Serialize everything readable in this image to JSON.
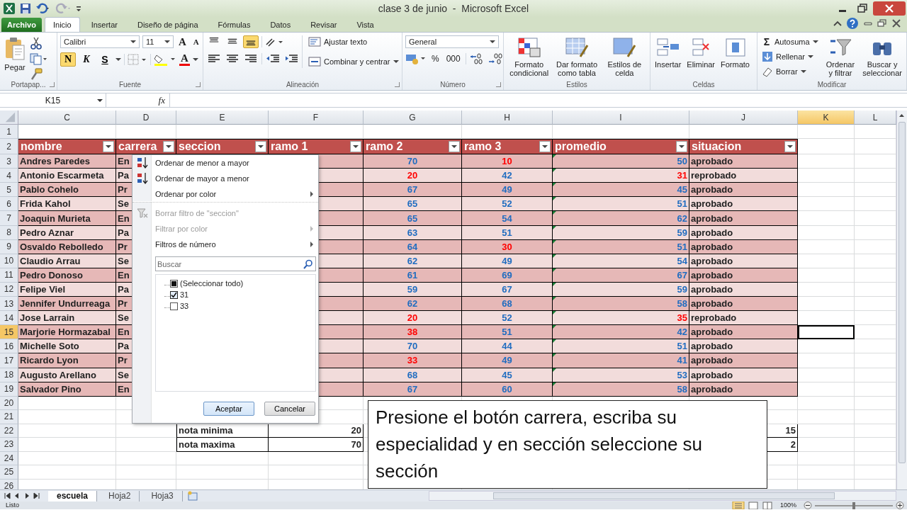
{
  "window": {
    "title": "clase 3 de junio  -  Microsoft Excel"
  },
  "ribbon_tabs": [
    {
      "label": "Archivo",
      "kind": "file",
      "selected": false
    },
    {
      "label": "Inicio",
      "kind": "tab",
      "selected": true
    },
    {
      "label": "Insertar",
      "kind": "tab",
      "selected": false
    },
    {
      "label": "Diseño de página",
      "kind": "tab",
      "selected": false
    },
    {
      "label": "Fórmulas",
      "kind": "tab",
      "selected": false
    },
    {
      "label": "Datos",
      "kind": "tab",
      "selected": false
    },
    {
      "label": "Revisar",
      "kind": "tab",
      "selected": false
    },
    {
      "label": "Vista",
      "kind": "tab",
      "selected": false
    }
  ],
  "clipboard": {
    "label": "Portapap...",
    "paste": "Pegar"
  },
  "font": {
    "label": "Fuente",
    "family": "Calibri",
    "size": "11",
    "size_glyphs": [
      "A",
      "A"
    ],
    "color_glyph": "A",
    "styles": [
      {
        "label": "N",
        "kind": "bold",
        "selected": true
      },
      {
        "label": "K",
        "kind": "italic",
        "selected": false
      },
      {
        "label": "S",
        "kind": "underline",
        "selected": false
      }
    ]
  },
  "alignment": {
    "label": "Alineación",
    "vertical": [
      {
        "selected": false
      },
      {
        "selected": false
      },
      {
        "selected": true
      }
    ],
    "wrap": "Ajustar texto",
    "merge": "Combinar y centrar"
  },
  "number": {
    "label": "Número",
    "format": "General",
    "percent": "%",
    "thousands": "000"
  },
  "styles": {
    "label": "Estilos",
    "buttons": [
      {
        "label": "Formato condicional",
        "kind": "conditional"
      },
      {
        "label": "Dar formato como tabla",
        "kind": "table"
      },
      {
        "label": "Estilos de celda",
        "kind": "cell"
      }
    ]
  },
  "cells": {
    "label": "Celdas",
    "buttons": [
      {
        "label": "Insertar",
        "kind": "insert"
      },
      {
        "label": "Eliminar",
        "kind": "delete"
      },
      {
        "label": "Formato",
        "kind": "format"
      }
    ]
  },
  "editing": {
    "label": "Modificar",
    "small": [
      {
        "label": "Autosuma",
        "kind": "sum",
        "glyph": "Σ"
      },
      {
        "label": "Rellenar",
        "kind": "fill"
      },
      {
        "label": "Borrar",
        "kind": "clear"
      }
    ],
    "big": [
      {
        "label": "Ordenar y filtrar",
        "kind": "sort"
      },
      {
        "label": "Buscar y seleccionar",
        "kind": "find"
      }
    ]
  },
  "formula_bar": {
    "name_box": "K15",
    "function_label": "fx"
  },
  "columns": [
    {
      "label": "C",
      "selected": false
    },
    {
      "label": "D",
      "selected": false
    },
    {
      "label": "E",
      "selected": false
    },
    {
      "label": "F",
      "selected": false
    },
    {
      "label": "G",
      "selected": false
    },
    {
      "label": "H",
      "selected": false
    },
    {
      "label": "I",
      "selected": false
    },
    {
      "label": "J",
      "selected": false
    },
    {
      "label": "K",
      "selected": true
    },
    {
      "label": "L",
      "selected": false
    }
  ],
  "table_headers": [
    "nombre",
    "carrera",
    "seccion",
    "ramo 1",
    "ramo 2",
    "ramo 3",
    "promedio",
    "situacion"
  ],
  "rows": [
    {
      "n": "1",
      "kind": "blank",
      "selected": false
    },
    {
      "n": "2",
      "kind": "header",
      "selected": false
    },
    {
      "n": "3",
      "kind": "data",
      "selected": false,
      "nombre": "Andres Paredes",
      "carrera": "En",
      "ramo_2": {
        "value": "70",
        "low": false
      },
      "ramo_3": {
        "value": "10",
        "low": true
      },
      "promedio": {
        "value": "50",
        "low": false
      },
      "situacion": "aprobado"
    },
    {
      "n": "4",
      "kind": "data",
      "selected": false,
      "nombre": "Antonio Escarmeta",
      "carrera": "Pa",
      "ramo_2": {
        "value": "20",
        "low": true
      },
      "ramo_3": {
        "value": "42",
        "low": false
      },
      "promedio": {
        "value": "31",
        "low": true
      },
      "situacion": "reprobado"
    },
    {
      "n": "5",
      "kind": "data",
      "selected": false,
      "nombre": "Pablo Cohelo",
      "carrera": "Pr",
      "ramo_2": {
        "value": "67",
        "low": false
      },
      "ramo_3": {
        "value": "49",
        "low": false
      },
      "promedio": {
        "value": "45",
        "low": false
      },
      "situacion": "aprobado"
    },
    {
      "n": "6",
      "kind": "data",
      "selected": false,
      "nombre": "Frida Kahol",
      "carrera": "Se",
      "ramo_2": {
        "value": "65",
        "low": false
      },
      "ramo_3": {
        "value": "52",
        "low": false
      },
      "promedio": {
        "value": "51",
        "low": false
      },
      "situacion": "aprobado"
    },
    {
      "n": "7",
      "kind": "data",
      "selected": false,
      "nombre": "Joaquin Murieta",
      "carrera": "En",
      "ramo_2": {
        "value": "65",
        "low": false
      },
      "ramo_3": {
        "value": "54",
        "low": false
      },
      "promedio": {
        "value": "62",
        "low": false
      },
      "situacion": "aprobado"
    },
    {
      "n": "8",
      "kind": "data",
      "selected": false,
      "nombre": "Pedro Aznar",
      "carrera": "Pa",
      "ramo_2": {
        "value": "63",
        "low": false
      },
      "ramo_3": {
        "value": "51",
        "low": false
      },
      "promedio": {
        "value": "59",
        "low": false
      },
      "situacion": "aprobado"
    },
    {
      "n": "9",
      "kind": "data",
      "selected": false,
      "nombre": "Osvaldo Rebolledo",
      "carrera": "Pr",
      "ramo_2": {
        "value": "64",
        "low": false
      },
      "ramo_3": {
        "value": "30",
        "low": true
      },
      "promedio": {
        "value": "51",
        "low": false
      },
      "situacion": "aprobado"
    },
    {
      "n": "10",
      "kind": "data",
      "selected": false,
      "nombre": "Claudio Arrau",
      "carrera": "Se",
      "ramo_2": {
        "value": "62",
        "low": false
      },
      "ramo_3": {
        "value": "49",
        "low": false
      },
      "promedio": {
        "value": "54",
        "low": false
      },
      "situacion": "aprobado"
    },
    {
      "n": "11",
      "kind": "data",
      "selected": false,
      "nombre": "Pedro Donoso",
      "carrera": "En",
      "ramo_2": {
        "value": "61",
        "low": false
      },
      "ramo_3": {
        "value": "69",
        "low": false
      },
      "promedio": {
        "value": "67",
        "low": false
      },
      "situacion": "aprobado"
    },
    {
      "n": "12",
      "kind": "data",
      "selected": false,
      "nombre": "Felipe Viel",
      "carrera": "Pa",
      "ramo_2": {
        "value": "59",
        "low": false
      },
      "ramo_3": {
        "value": "67",
        "low": false
      },
      "promedio": {
        "value": "59",
        "low": false
      },
      "situacion": "aprobado"
    },
    {
      "n": "13",
      "kind": "data",
      "selected": false,
      "nombre": "Jennifer Undurreaga",
      "carrera": "Pr",
      "ramo_2": {
        "value": "62",
        "low": false
      },
      "ramo_3": {
        "value": "68",
        "low": false
      },
      "promedio": {
        "value": "58",
        "low": false
      },
      "situacion": "aprobado"
    },
    {
      "n": "14",
      "kind": "data",
      "selected": false,
      "nombre": "Jose Larrain",
      "carrera": "Se",
      "ramo_2": {
        "value": "20",
        "low": true
      },
      "ramo_3": {
        "value": "52",
        "low": false
      },
      "promedio": {
        "value": "35",
        "low": true
      },
      "situacion": "reprobado"
    },
    {
      "n": "15",
      "kind": "data",
      "selected": true,
      "nombre": "Marjorie Hormazabal",
      "carrera": "En",
      "ramo_2": {
        "value": "38",
        "low": true
      },
      "ramo_3": {
        "value": "51",
        "low": false
      },
      "promedio": {
        "value": "42",
        "low": false
      },
      "situacion": "aprobado"
    },
    {
      "n": "16",
      "kind": "data",
      "selected": false,
      "nombre": "Michelle Soto",
      "carrera": "Pa",
      "ramo_2": {
        "value": "70",
        "low": false
      },
      "ramo_3": {
        "value": "44",
        "low": false
      },
      "promedio": {
        "value": "51",
        "low": false
      },
      "situacion": "aprobado"
    },
    {
      "n": "17",
      "kind": "data",
      "selected": false,
      "nombre": "Ricardo Lyon",
      "carrera": "Pr",
      "ramo_2": {
        "value": "33",
        "low": true
      },
      "ramo_3": {
        "value": "49",
        "low": false
      },
      "promedio": {
        "value": "41",
        "low": false
      },
      "situacion": "aprobado"
    },
    {
      "n": "18",
      "kind": "data",
      "selected": false,
      "nombre": "Augusto Arellano",
      "carrera": "Se",
      "ramo_2": {
        "value": "68",
        "low": false
      },
      "ramo_3": {
        "value": "45",
        "low": false
      },
      "promedio": {
        "value": "53",
        "low": false
      },
      "situacion": "aprobado"
    },
    {
      "n": "19",
      "kind": "data",
      "selected": false,
      "nombre": "Salvador Pino",
      "carrera": "En",
      "ramo_2": {
        "value": "67",
        "low": false
      },
      "ramo_3": {
        "value": "60",
        "low": false
      },
      "promedio": {
        "value": "58",
        "low": false
      },
      "situacion": "aprobado"
    },
    {
      "n": "20",
      "kind": "blank",
      "selected": false
    },
    {
      "n": "21",
      "kind": "blank",
      "selected": false
    },
    {
      "n": "22",
      "kind": "stat",
      "selected": false,
      "label": "nota minima",
      "value": "20",
      "column_j": "15"
    },
    {
      "n": "23",
      "kind": "stat",
      "selected": false,
      "label": "nota maxima",
      "value": "70",
      "column_j": "2"
    },
    {
      "n": "24",
      "kind": "blank",
      "selected": false
    },
    {
      "n": "25",
      "kind": "blank",
      "selected": false
    },
    {
      "n": "26",
      "kind": "blank",
      "selected": false
    }
  ],
  "filter_menu": {
    "items": [
      {
        "label": "Ordenar de menor a mayor",
        "kind": "sort-asc",
        "disabled": false,
        "submenu": false,
        "divider_after": false
      },
      {
        "label": "Ordenar de mayor a menor",
        "kind": "sort-desc",
        "disabled": false,
        "submenu": false,
        "divider_after": false
      },
      {
        "label": "Ordenar por color",
        "kind": "plain",
        "disabled": false,
        "submenu": true,
        "divider_after": true
      },
      {
        "label": "Borrar filtro de \"seccion\"",
        "kind": "clear-filter",
        "disabled": true,
        "submenu": false,
        "divider_after": false
      },
      {
        "label": "Filtrar por color",
        "kind": "plain",
        "disabled": true,
        "submenu": true,
        "divider_after": false
      },
      {
        "label": "Filtros de número",
        "kind": "plain",
        "disabled": false,
        "submenu": true,
        "divider_after": false
      }
    ],
    "search": {
      "placeholder": "Buscar"
    },
    "values": [
      {
        "label": "(Seleccionar todo)",
        "kind": "select-all",
        "checked": false,
        "mixed": true
      },
      {
        "label": "31",
        "kind": "value",
        "checked": true
      },
      {
        "label": "33",
        "kind": "value",
        "checked": false
      }
    ],
    "buttons": [
      {
        "label": "Aceptar",
        "kind": "default"
      },
      {
        "label": "Cancelar",
        "kind": "normal"
      }
    ]
  },
  "callout": {
    "text": "Presione el botón carrera, escriba su especialidad y en sección seleccione su sección"
  },
  "sheet_tabs": [
    {
      "label": "escuela",
      "selected": true
    },
    {
      "label": "Hoja2",
      "selected": false
    },
    {
      "label": "Hoja3",
      "selected": false
    }
  ],
  "status_bar": {
    "status": "Listo",
    "zoom": "100%",
    "zoom_slider": {
      "level": 0.5
    }
  }
}
